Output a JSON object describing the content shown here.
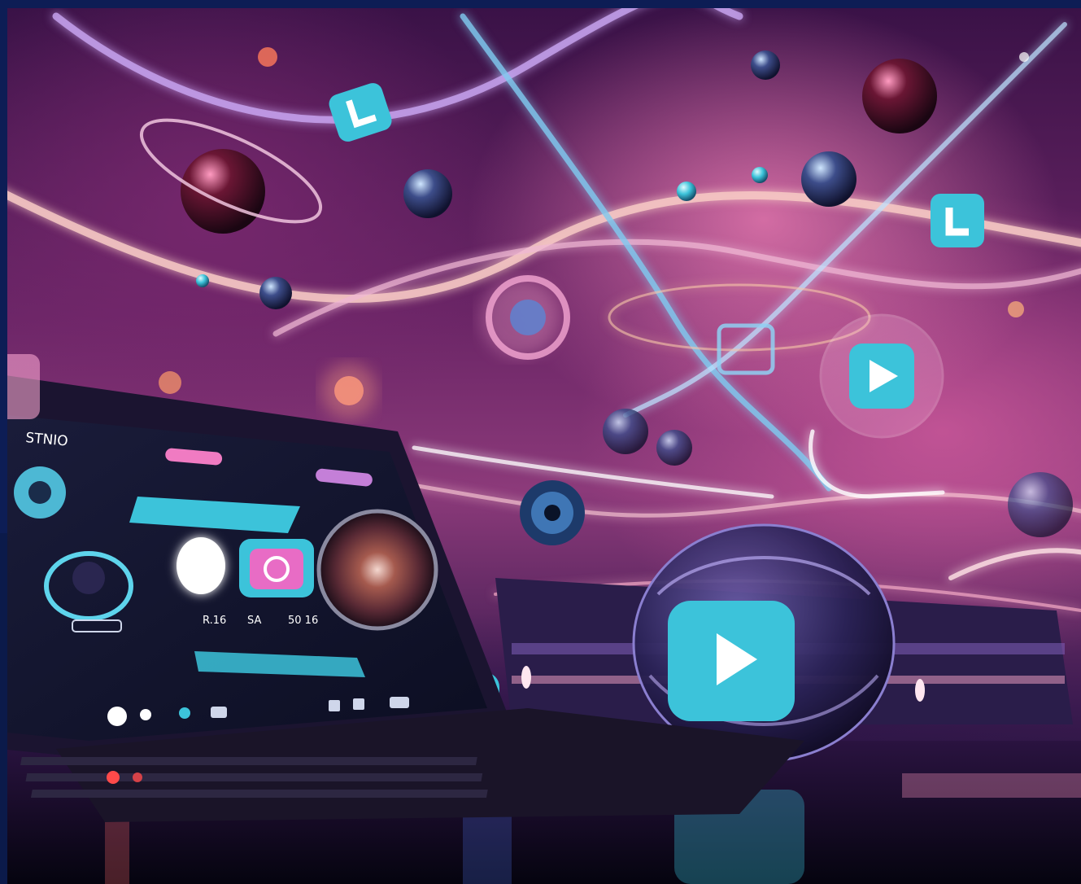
{
  "scene": {
    "description_colors": {
      "accent_cyan": "#3cc3da",
      "glow_pink": "#f2a6c8",
      "deep_purple": "#2a0f3d",
      "frame_navy": "#0d1d55"
    }
  },
  "laptop_screen": {
    "app_name": "STNIO",
    "readouts": [
      "R.16",
      "SA",
      "50 16"
    ]
  },
  "icons": {
    "floating_tiles": [
      "letter-l-tile-icon",
      "letter-l-tile-icon",
      "play-d-bubble-icon",
      "play-tile-icon",
      "play-tile-icon"
    ],
    "big_play": "play-icon"
  }
}
